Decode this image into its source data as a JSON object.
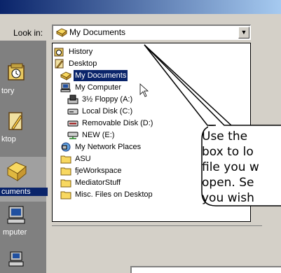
{
  "look_in_label": "Look in:",
  "current_folder": "My Documents",
  "dropdown_arrow": "▼",
  "dropdown_items": [
    {
      "label": "History",
      "icon": "history-icon"
    },
    {
      "label": "Desktop",
      "icon": "desktop-icon"
    },
    {
      "label": "My Documents",
      "icon": "my-documents-icon",
      "selected": true
    },
    {
      "label": "My Computer",
      "icon": "my-computer-icon"
    },
    {
      "label": "3½ Floppy (A:)",
      "icon": "floppy-drive-icon"
    },
    {
      "label": "Local Disk (C:)",
      "icon": "local-disk-icon"
    },
    {
      "label": "Removable Disk (D:)",
      "icon": "removable-disk-icon"
    },
    {
      "label": "NEW (E:)",
      "icon": "network-drive-icon"
    },
    {
      "label": "My Network Places",
      "icon": "network-places-icon"
    },
    {
      "label": "ASU",
      "icon": "folder-icon"
    },
    {
      "label": "fjeWorkspace",
      "icon": "folder-icon"
    },
    {
      "label": "MediatorStuff",
      "icon": "folder-icon"
    },
    {
      "label": "Misc. Files on Desktop",
      "icon": "folder-icon"
    }
  ],
  "sidebar_places": [
    {
      "label": "tory",
      "icon": "history-icon"
    },
    {
      "label": "ktop",
      "icon": "desktop-icon"
    },
    {
      "label": "cuments",
      "icon": "my-documents-icon",
      "selected": true
    },
    {
      "label": "mputer",
      "icon": "my-computer-icon"
    }
  ],
  "callout_lines": [
    "Use the",
    "box to lo",
    "file you w",
    "open. Se",
    "you wish"
  ],
  "colors": {
    "title_bar": "#0a246a",
    "dialog_bg": "#d4d0c8",
    "sidebar_bg": "#808080",
    "selection": "#0a246a",
    "folder_yellow": "#f8d860"
  }
}
